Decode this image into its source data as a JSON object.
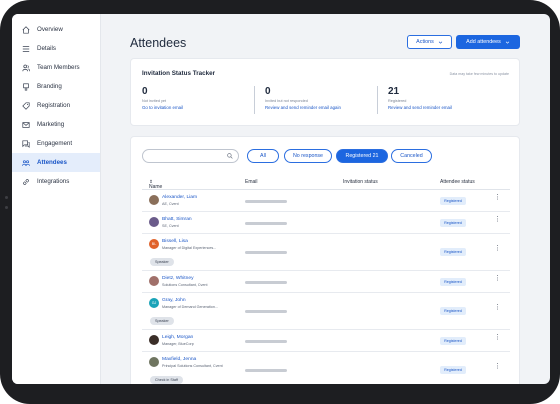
{
  "sidebar": {
    "items": [
      {
        "label": "Overview",
        "icon": "home-icon"
      },
      {
        "label": "Details",
        "icon": "list-icon"
      },
      {
        "label": "Team Members",
        "icon": "team-icon"
      },
      {
        "label": "Branding",
        "icon": "branding-icon"
      },
      {
        "label": "Registration",
        "icon": "tag-icon"
      },
      {
        "label": "Marketing",
        "icon": "mail-icon"
      },
      {
        "label": "Engagement",
        "icon": "chat-icon"
      },
      {
        "label": "Attendees",
        "icon": "attendees-icon",
        "active": true
      },
      {
        "label": "Integrations",
        "icon": "link-icon"
      }
    ]
  },
  "header": {
    "title": "Attendees",
    "actions_label": "Actions",
    "add_label": "Add attendees"
  },
  "tracker": {
    "title": "Invitation Status Tracker",
    "note": "Data may take few minutes to update",
    "stats": [
      {
        "value": "0",
        "label": "Not invited yet",
        "link": "Go to invitation email"
      },
      {
        "value": "0",
        "label": "Invited but not responded",
        "link": "Review and send reminder email again"
      },
      {
        "value": "21",
        "label": "Registered",
        "link": "Review and send reminder email"
      }
    ]
  },
  "filters": {
    "search_placeholder": "",
    "pills": [
      {
        "label": "All",
        "selected": false
      },
      {
        "label": "No response",
        "selected": false
      },
      {
        "label": "Registered 21",
        "selected": true
      },
      {
        "label": "Canceled",
        "selected": false
      }
    ]
  },
  "table": {
    "headers": {
      "name": "Name",
      "email": "Email",
      "invitation": "Invitation status",
      "attendee": "Attendee status"
    },
    "rows": [
      {
        "name": "Alexander, Liam",
        "sub": "AE, Cvent",
        "tag": "",
        "status": "Registered",
        "avatar_color": "#8a6f5a"
      },
      {
        "name": "Bhatt, Simran",
        "sub": "SE, Cvent",
        "tag": "",
        "status": "Registered",
        "avatar_color": "#6a5b8a"
      },
      {
        "name": "Bissell, Lisa",
        "sub": "Manager of Digital Experiences...",
        "tag": "Speaker",
        "status": "Registered",
        "avatar_color": "#e0622a",
        "initials": "BL"
      },
      {
        "name": "Dietz, Whitney",
        "sub": "Solutions Consultant, Cvent",
        "tag": "",
        "status": "Registered",
        "avatar_color": "#a0706a"
      },
      {
        "name": "Gray, John",
        "sub": "Manager of Demand Generation...",
        "tag": "Speaker",
        "status": "Registered",
        "avatar_color": "#1aa3b8",
        "initials": "GJ"
      },
      {
        "name": "Leigh, Morgan",
        "sub": "Manager, BlueCorp",
        "tag": "",
        "status": "Registered",
        "avatar_color": "#3a2e28"
      },
      {
        "name": "Maxfield, Jenna",
        "sub": "Principal Solutions Consultant, Cvent",
        "tag": "Check in Staff",
        "status": "Registered",
        "avatar_color": "#6f7560"
      }
    ]
  }
}
